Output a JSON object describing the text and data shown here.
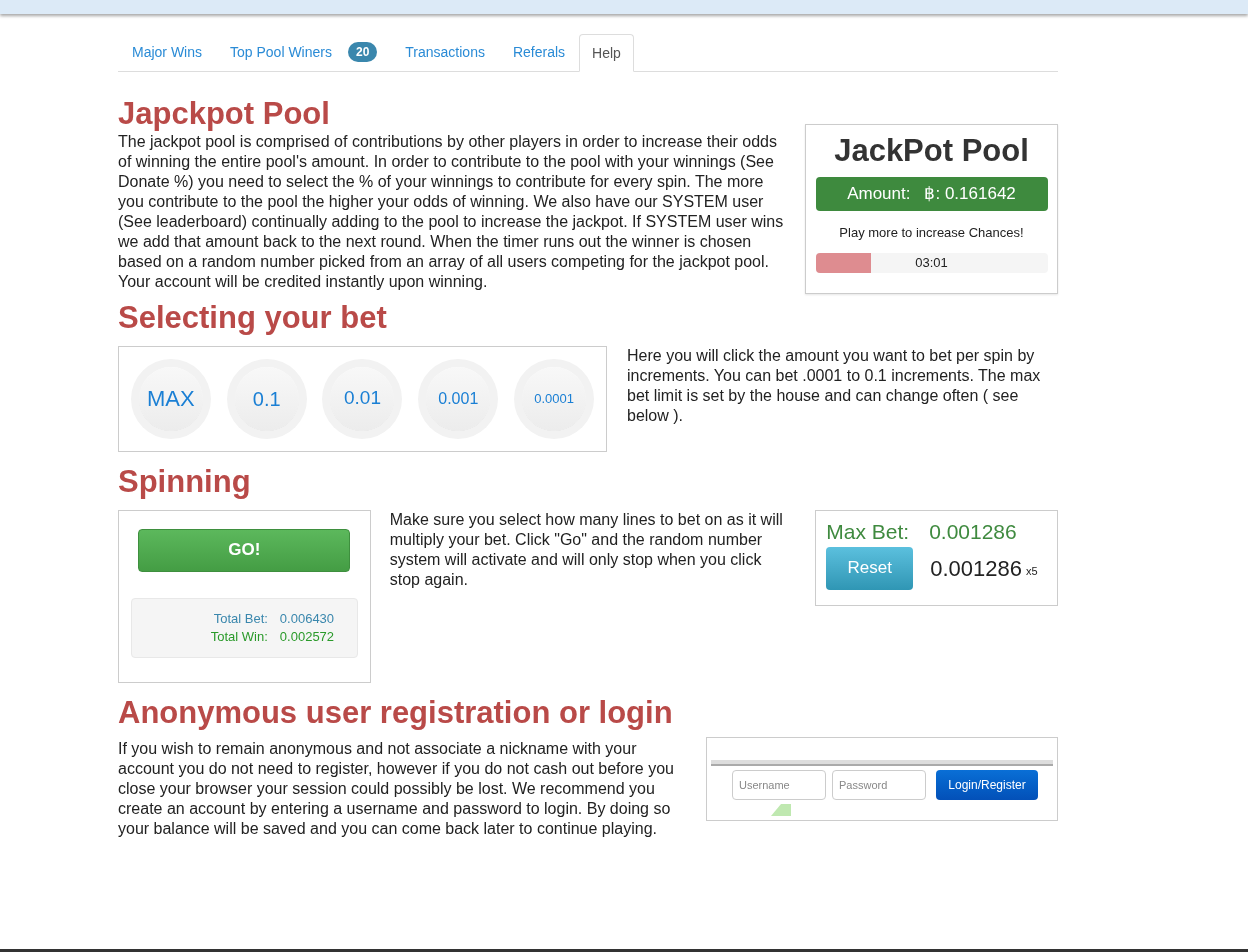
{
  "tabs": [
    {
      "label": "Major Wins",
      "selected": false
    },
    {
      "label": "Top Pool Winers",
      "badge": "20",
      "selected": false
    },
    {
      "label": "Transactions",
      "selected": false
    },
    {
      "label": "Referals",
      "selected": false
    },
    {
      "label": "Help",
      "selected": true
    }
  ],
  "jackpot": {
    "heading": "Japckpot Pool",
    "text": "The jackpot pool is comprised of contributions by other players in order to increase their odds of winning the entire pool's amount. In order to contribute to the pool with your winnings (See Donate %) you need to select the % of your winnings to contribute for every spin. The more you contribute to the pool the higher your odds of winning. We also have our SYSTEM user (See leaderboard) continually adding to the pool to increase the jackpot. If SYSTEM user wins we add that amount back to the next round. When the timer runs out the winner is chosen based on a random number picked from an array of all users competing for the jackpot pool. Your account will be credited instantly upon winning.",
    "widget": {
      "title": "JackPot Pool",
      "amount_label": "Amount:",
      "amount": "฿: 0.161642",
      "hint": "Play more to increase Chances!",
      "timer": "03:01",
      "level": 0.24
    }
  },
  "bet": {
    "heading": "Selecting your bet",
    "chips": [
      "MAX",
      "0.1",
      "0.01",
      "0.001",
      "0.0001"
    ],
    "text": "Here you will click the amount you want to bet per spin by increments. You can bet .0001 to 0.1 increments. The max bet limit is set by the house and can change often ( see below )."
  },
  "spinning": {
    "heading": "Spinning",
    "go": "GO!",
    "total_bet_label": "Total Bet:",
    "total_bet": "0.006430",
    "total_win_label": "Total Win:",
    "total_win": "0.002572",
    "text": "Make sure you select how many lines to bet on as it will multiply your bet. Click \"Go\" and the random number system will activate and will only stop when you click stop again.",
    "max_bet_label": "Max Bet:",
    "max_bet": "0.001286",
    "reset": "Reset",
    "bet_value": "0.001286",
    "multiplier": "x5"
  },
  "login": {
    "heading": "Anonymous user registration or login",
    "text": "If you wish to remain anonymous and not associate a nickname with your account you do not need to register, however if you do not cash out before you close your browser your session could possibly be lost. We recommend you create an account by entering a username and password to login. By doing so your balance will be saved and you can come back later to continue playing.",
    "username_placeholder": "Username",
    "password_placeholder": "Password",
    "button": "Login/Register"
  }
}
